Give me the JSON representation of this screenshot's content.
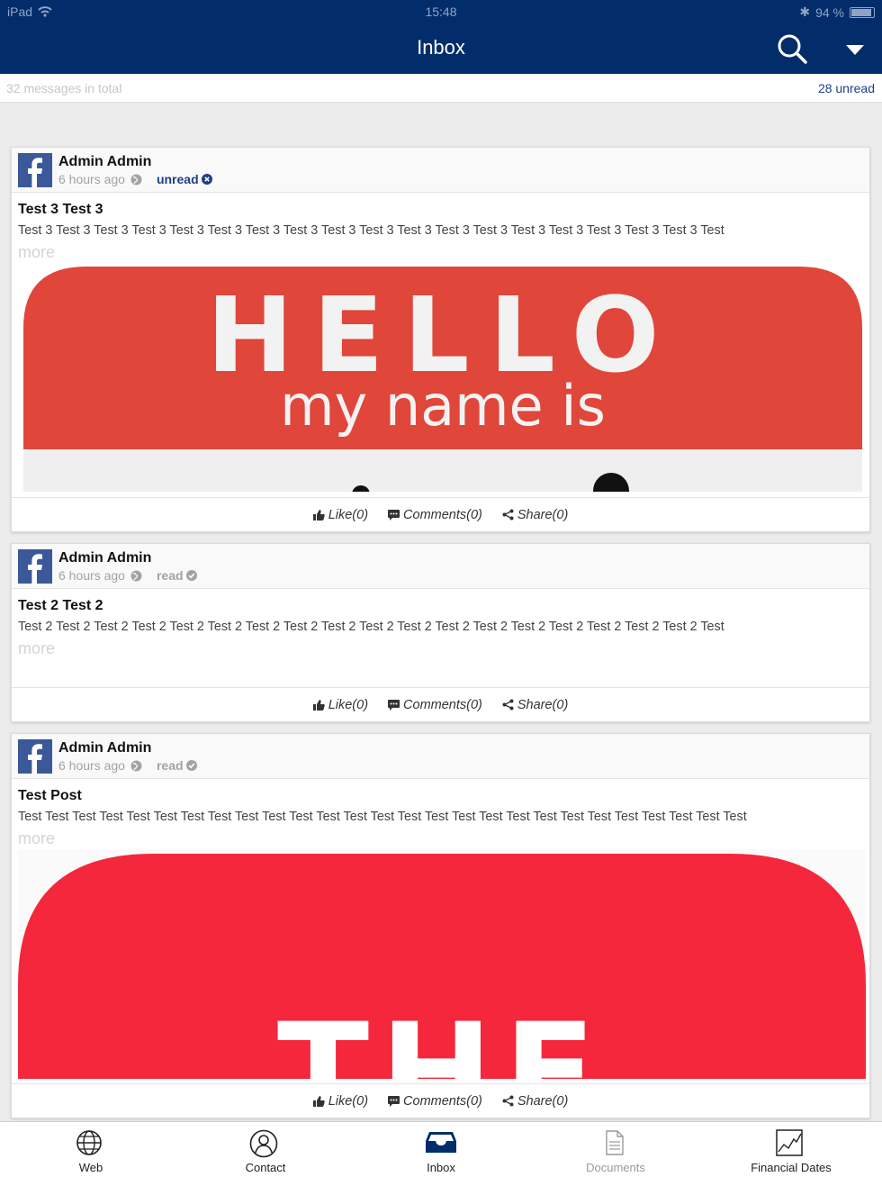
{
  "status": {
    "device": "iPad",
    "time": "15:48",
    "battery": "94 %"
  },
  "header": {
    "title": "Inbox"
  },
  "infobar": {
    "total": "32 messages in total",
    "unread": "28 unread"
  },
  "posts": [
    {
      "author": "Admin Admin",
      "time": "6 hours ago",
      "status": "unread",
      "title": "Test 3 Test 3",
      "body": "Test 3 Test 3 Test 3 Test 3 Test 3 Test 3 Test 3 Test 3 Test 3 Test 3 Test 3 Test 3 Test 3 Test 3 Test 3 Test 3 Test 3 Test 3 Test",
      "more": "more",
      "image_text_1": "HELLO",
      "image_text_2": "my name is",
      "like": "Like(0)",
      "comments": "Comments(0)",
      "share": "Share(0)"
    },
    {
      "author": "Admin Admin",
      "time": "6 hours ago",
      "status": "read",
      "title": "Test 2 Test 2",
      "body": "Test 2 Test 2 Test 2 Test 2 Test 2 Test 2 Test 2 Test 2 Test 2 Test 2 Test 2 Test 2 Test 2 Test 2 Test 2 Test 2 Test 2 Test 2 Test",
      "more": "more",
      "like": "Like(0)",
      "comments": "Comments(0)",
      "share": "Share(0)"
    },
    {
      "author": "Admin Admin",
      "time": "6 hours ago",
      "status": "read",
      "title": "Test Post",
      "body": "Test Test Test Test Test Test Test Test Test Test Test Test Test Test Test Test Test Test Test Test Test Test Test Test Test Test Test",
      "more": "more",
      "image_text_1": "THE",
      "like": "Like(0)",
      "comments": "Comments(0)",
      "share": "Share(0)"
    }
  ],
  "tabs": [
    {
      "label": "Web",
      "icon": "globe-icon"
    },
    {
      "label": "Contact",
      "icon": "contact-icon"
    },
    {
      "label": "Inbox",
      "icon": "inbox-icon"
    },
    {
      "label": "Documents",
      "icon": "document-icon"
    },
    {
      "label": "Financial Dates",
      "icon": "chart-icon"
    }
  ],
  "colors": {
    "header": "#032d6a",
    "accent": "#1c3f8a",
    "facebook": "#3b5998",
    "hello_red": "#e0463a",
    "the_red": "#f5273c"
  }
}
